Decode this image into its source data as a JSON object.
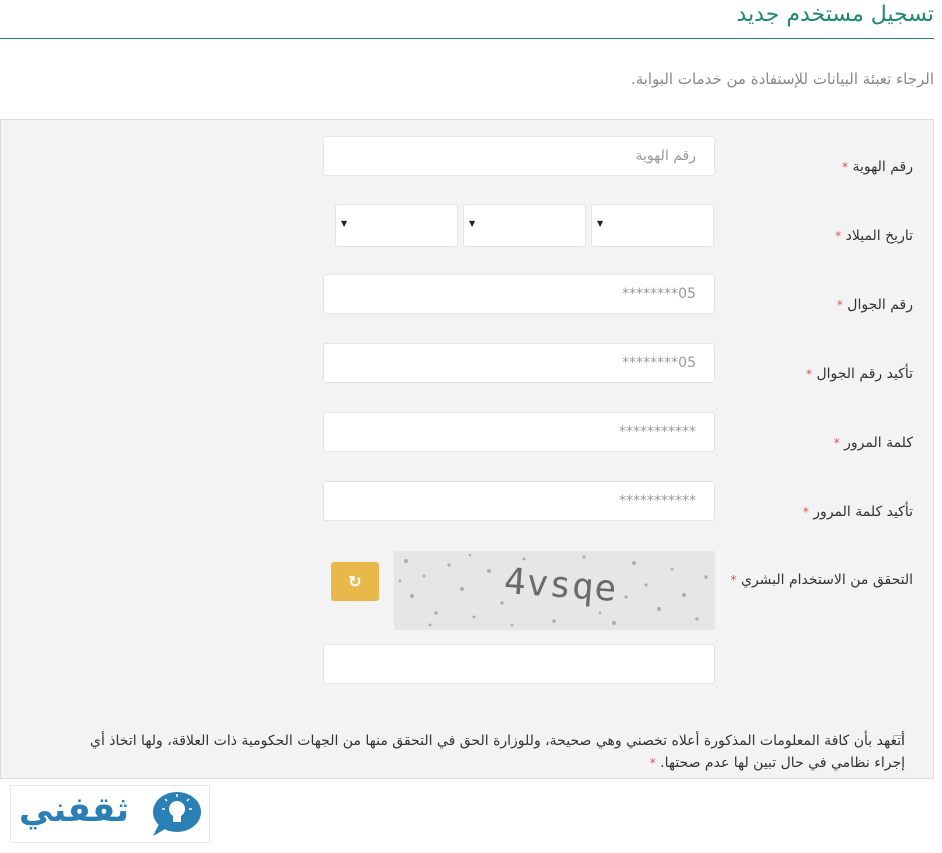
{
  "header": {
    "title": "تسجيل مستخدم جديد",
    "intro": "الرجاء تعبئة البيانات للإستفادة من خدمات البوابة."
  },
  "form": {
    "required_mark": "*",
    "id_number": {
      "label": "رقم الهوية",
      "placeholder": "رقم الهوية"
    },
    "birth_date": {
      "label": "تاريخ الميلاد",
      "selects": [
        "",
        "",
        ""
      ]
    },
    "mobile": {
      "label": "رقم الجوال",
      "placeholder": "05********"
    },
    "mobile_confirm": {
      "label": "تأكيد رقم الجوال",
      "placeholder": "05********"
    },
    "password": {
      "label": "كلمة المرور",
      "placeholder": "***********"
    },
    "password_confirm": {
      "label": "تأكيد كلمة المرور",
      "placeholder": "***********"
    },
    "captcha": {
      "label": "التحقق من الاستخدام البشري",
      "image_text": "4vsqe",
      "answer_value": ""
    },
    "terms": {
      "text": "أتعهد بأن كافة المعلومات المذكورة أعلاه تخصني وهي صحيحة، وللوزارة الحق في التحقق منها من الجهات الحكومية ذات العلاقة، ولها اتخاذ أي إجراء نظامي في حال تبين لها عدم صحتها.",
      "checked": false
    }
  },
  "logo": {
    "text": "ثقفني",
    "icon": "lightbulb-icon"
  },
  "colors": {
    "accent": "#1f8a6b",
    "required": "#d9534f",
    "refresh_button": "#e8b94a",
    "logo": "#2a7fb5"
  }
}
